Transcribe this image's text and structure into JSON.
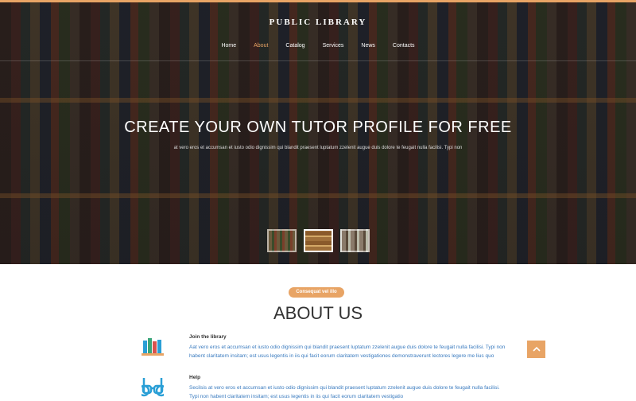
{
  "header": {
    "brand": "PUBLIC LIBRARY",
    "nav": [
      "Home",
      "About",
      "Catalog",
      "Services",
      "News",
      "Contacts"
    ],
    "active_index": 1
  },
  "hero": {
    "title": "CREATE YOUR OWN TUTOR PROFILE FOR FREE",
    "subtitle": "at vero eros et accumsan et iusto odio dignissim qui blandit praesent luptatum zzelenit augue duis dolore te feugait nulla facilisi. Typi non"
  },
  "about": {
    "badge": "Consequat vel illo",
    "title": "ABOUT US",
    "features": [
      {
        "icon": "books-icon",
        "heading": "Join the library",
        "text": "Aat vero eros et accumsan et iusto odio dignissim qui blandit praesent luptatum zzelenit augue duis dolore te feugait nulla facilisi. Typi non habent claritatem insitam; est usus legentis in iis qui facit eorum claritatem vestigationes demonstraverunt lectores legere me lius quo"
      },
      {
        "icon": "glasses-icon",
        "heading": "Help",
        "text": "Secilsis at vero eros et accumsan et iusto odio dignissim qui blandit praesent luptatum zzelenit augue duis dolore te feugait nulla facilisi. Typi non habent claritatem insitam; est usus legentis in iis qui facit eorum claritatem vestigatio"
      }
    ]
  },
  "colors": {
    "accent": "#e8a465",
    "link": "#3a7bbf",
    "icon_blue": "#2a9fd6"
  }
}
